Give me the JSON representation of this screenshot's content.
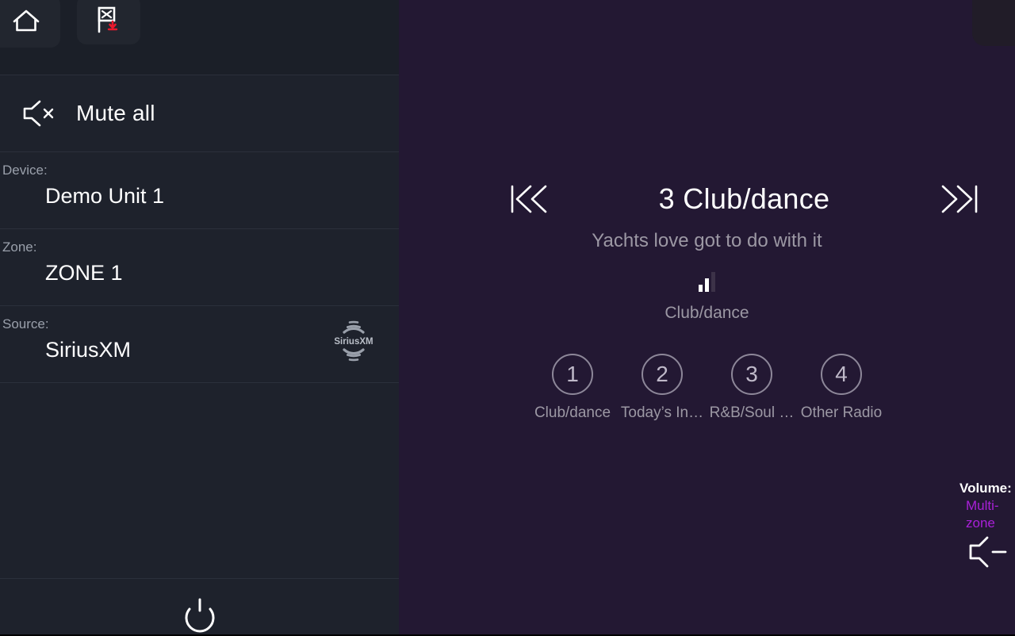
{
  "sidebar": {
    "home_button": "home-icon",
    "flag_button": "flag-x-download-icon",
    "mute": {
      "label": "Mute all",
      "icon": "speaker-mute-icon"
    },
    "info": [
      {
        "key": "Device:",
        "value": "Demo Unit 1"
      },
      {
        "key": "Zone:",
        "value": "ZONE 1"
      },
      {
        "key": "Source:",
        "value": "SiriusXM",
        "logo_text": "SiriusXM"
      }
    ],
    "power_button": "power-icon"
  },
  "player": {
    "prev_label": "skip-backward-icon",
    "next_label": "skip-forward-icon",
    "title": "3 Club/dance",
    "subtitle": "Yachts love got to do with it",
    "station_name": "Club/dance",
    "signal_bars_lit": 2,
    "signal_bars_total": 3
  },
  "presets": [
    {
      "number": "1",
      "label": "Club/dance"
    },
    {
      "number": "2",
      "label": "Today’s In…"
    },
    {
      "number": "3",
      "label": "R&B/Soul …"
    },
    {
      "number": "4",
      "label": "Other Radio"
    }
  ],
  "volume": {
    "caption": "Volume:",
    "mode": "Multi-zone",
    "down_icon": "volume-down-icon",
    "up_icon": "volume-up-icon",
    "stop_icon": "stop-square-icon",
    "level_meter_icon": "level-meter-icon"
  },
  "colors": {
    "sidebar_bg": "#1e222c",
    "main_bg": "#231833",
    "accent_purple": "#a920d8",
    "flag_arrow_red": "#e8192c",
    "divider": "#2b303b",
    "muted_text": "#9c98a4",
    "dial_arc": "#8d8d8d"
  }
}
